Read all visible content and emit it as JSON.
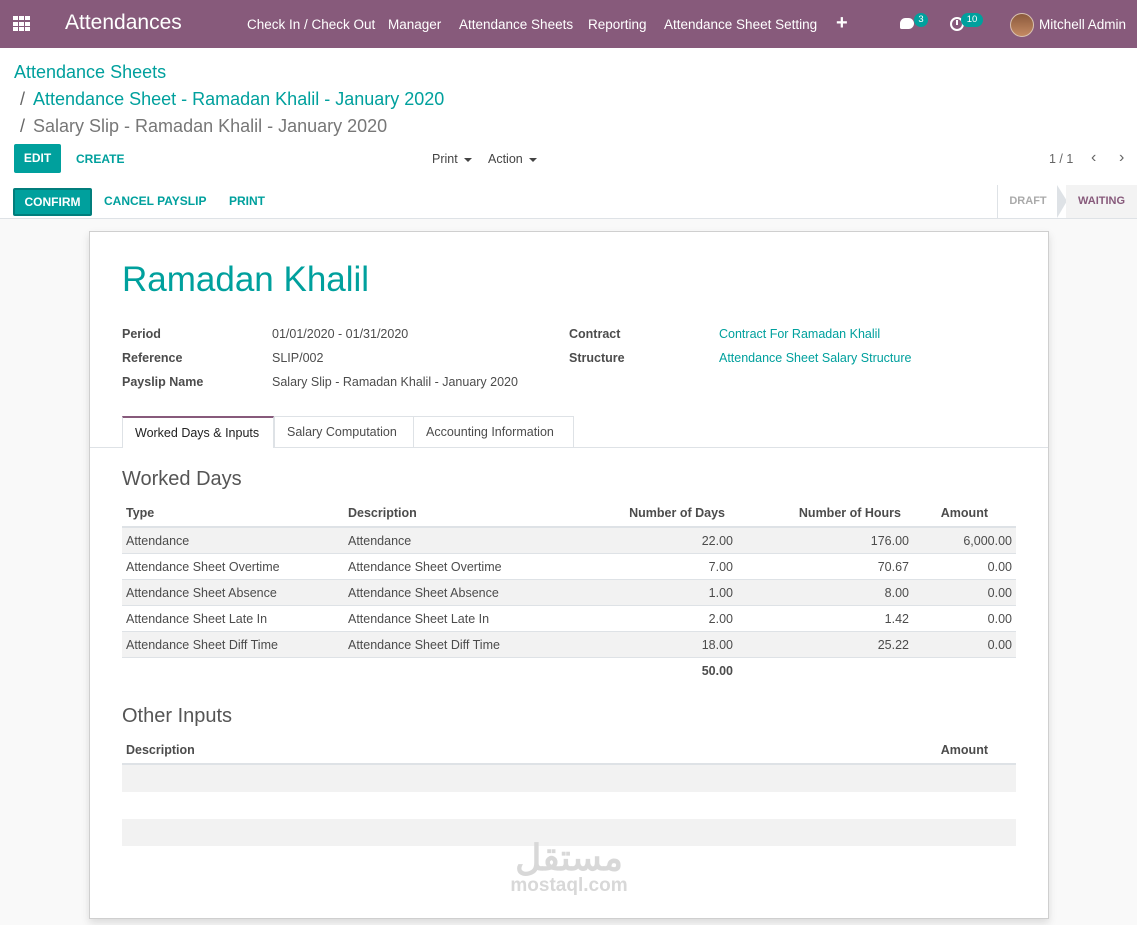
{
  "nav": {
    "app_title": "Attendances",
    "menu": [
      "Check In / Check Out",
      "Manager",
      "Attendance Sheets",
      "Reporting",
      "Attendance Sheet Setting"
    ],
    "plus": "+",
    "chat_count": "3",
    "activity_count": "10",
    "user": "Mitchell Admin"
  },
  "breadcrumb": {
    "root": "Attendance Sheets",
    "parent": "Attendance Sheet - Ramadan Khalil - January 2020",
    "current": "Salary Slip - Ramadan Khalil - January 2020",
    "separator": "/"
  },
  "buttons": {
    "edit": "EDIT",
    "create": "CREATE",
    "print": "Print",
    "action": "Action"
  },
  "pager": {
    "value": "1 / 1",
    "prev": "‹",
    "next": "›"
  },
  "statusbar": {
    "confirm": "CONFIRM",
    "cancel": "CANCEL PAYSLIP",
    "print": "PRINT",
    "stages": [
      "DRAFT",
      "WAITING"
    ]
  },
  "record": {
    "name": "Ramadan Khalil",
    "fields": {
      "period_label": "Period",
      "period": "01/01/2020 - 01/31/2020",
      "reference_label": "Reference",
      "reference": "SLIP/002",
      "payslip_name_label": "Payslip Name",
      "payslip_name": "Salary Slip - Ramadan Khalil - January 2020",
      "contract_label": "Contract",
      "contract": "Contract For Ramadan Khalil",
      "structure_label": "Structure",
      "structure": "Attendance Sheet Salary Structure"
    }
  },
  "tabs": [
    "Worked Days & Inputs",
    "Salary Computation",
    "Accounting Information"
  ],
  "worked_days": {
    "title": "Worked Days",
    "headers": [
      "Type",
      "Description",
      "Number of Days",
      "Number of Hours",
      "Amount"
    ],
    "rows": [
      [
        "Attendance",
        "Attendance",
        "22.00",
        "176.00",
        "6,000.00"
      ],
      [
        "Attendance Sheet Overtime",
        "Attendance Sheet Overtime",
        "7.00",
        "70.67",
        "0.00"
      ],
      [
        "Attendance Sheet Absence",
        "Attendance Sheet Absence",
        "1.00",
        "8.00",
        "0.00"
      ],
      [
        "Attendance Sheet Late In",
        "Attendance Sheet Late In",
        "2.00",
        "1.42",
        "0.00"
      ],
      [
        "Attendance Sheet Diff Time",
        "Attendance Sheet Diff Time",
        "18.00",
        "25.22",
        "0.00"
      ]
    ],
    "total_days": "50.00"
  },
  "other_inputs": {
    "title": "Other Inputs",
    "headers": [
      "Description",
      "Amount"
    ]
  },
  "watermark": {
    "arabic": "مستقل",
    "latin": "mostaql.com"
  }
}
